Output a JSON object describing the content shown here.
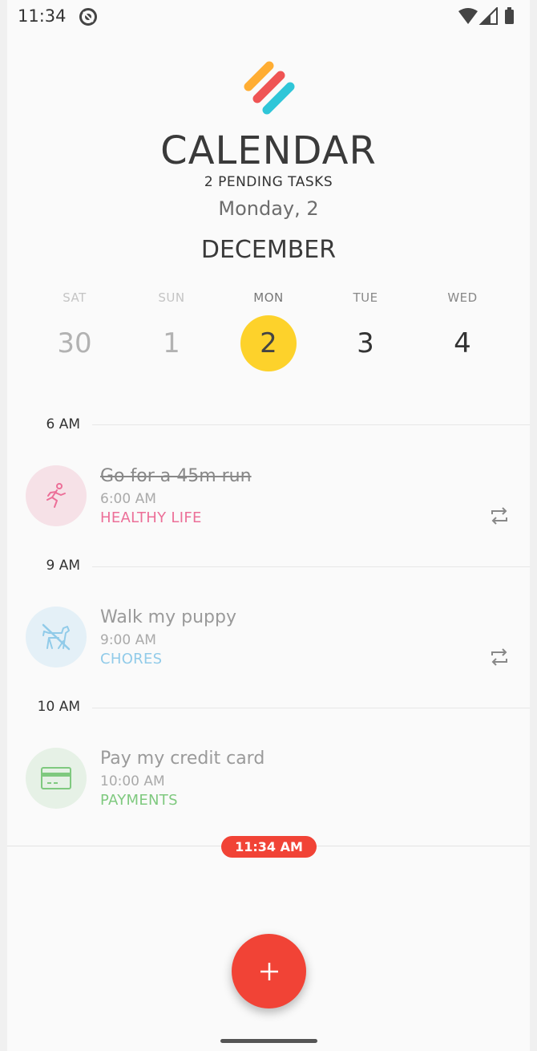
{
  "status_bar": {
    "time": "11:34"
  },
  "header": {
    "title": "CALENDAR",
    "pending": "2 PENDING TASKS",
    "date": "Monday, 2",
    "month": "DECEMBER"
  },
  "days": [
    {
      "name": "SAT",
      "num": "30",
      "state": "past"
    },
    {
      "name": "SUN",
      "num": "1",
      "state": "past"
    },
    {
      "name": "MON",
      "num": "2",
      "state": "current"
    },
    {
      "name": "TUE",
      "num": "3",
      "state": "future"
    },
    {
      "name": "WED",
      "num": "4",
      "state": "future"
    }
  ],
  "hours": [
    "6 AM",
    "9 AM",
    "10 AM"
  ],
  "tasks": [
    {
      "title": "Go for a 45m run",
      "time": "6:00 AM",
      "category": "HEALTHY LIFE",
      "icon": "running-person-icon",
      "color": "#ec6f98",
      "bg": "#f6e1e7",
      "completed": true,
      "repeat": true
    },
    {
      "title": "Walk my puppy",
      "time": "9:00 AM",
      "category": "CHORES",
      "icon": "dog-icon",
      "color": "#91cbe9",
      "bg": "#e4f0f7",
      "completed": false,
      "repeat": true
    },
    {
      "title": "Pay my credit card",
      "time": "10:00 AM",
      "category": "PAYMENTS",
      "icon": "credit-card-icon",
      "color": "#7fc97f",
      "bg": "#e6f1e6",
      "completed": false,
      "repeat": false
    }
  ],
  "now_badge": "11:34 AM",
  "colors": {
    "accent": "#f14336",
    "today": "#fdd22b"
  }
}
